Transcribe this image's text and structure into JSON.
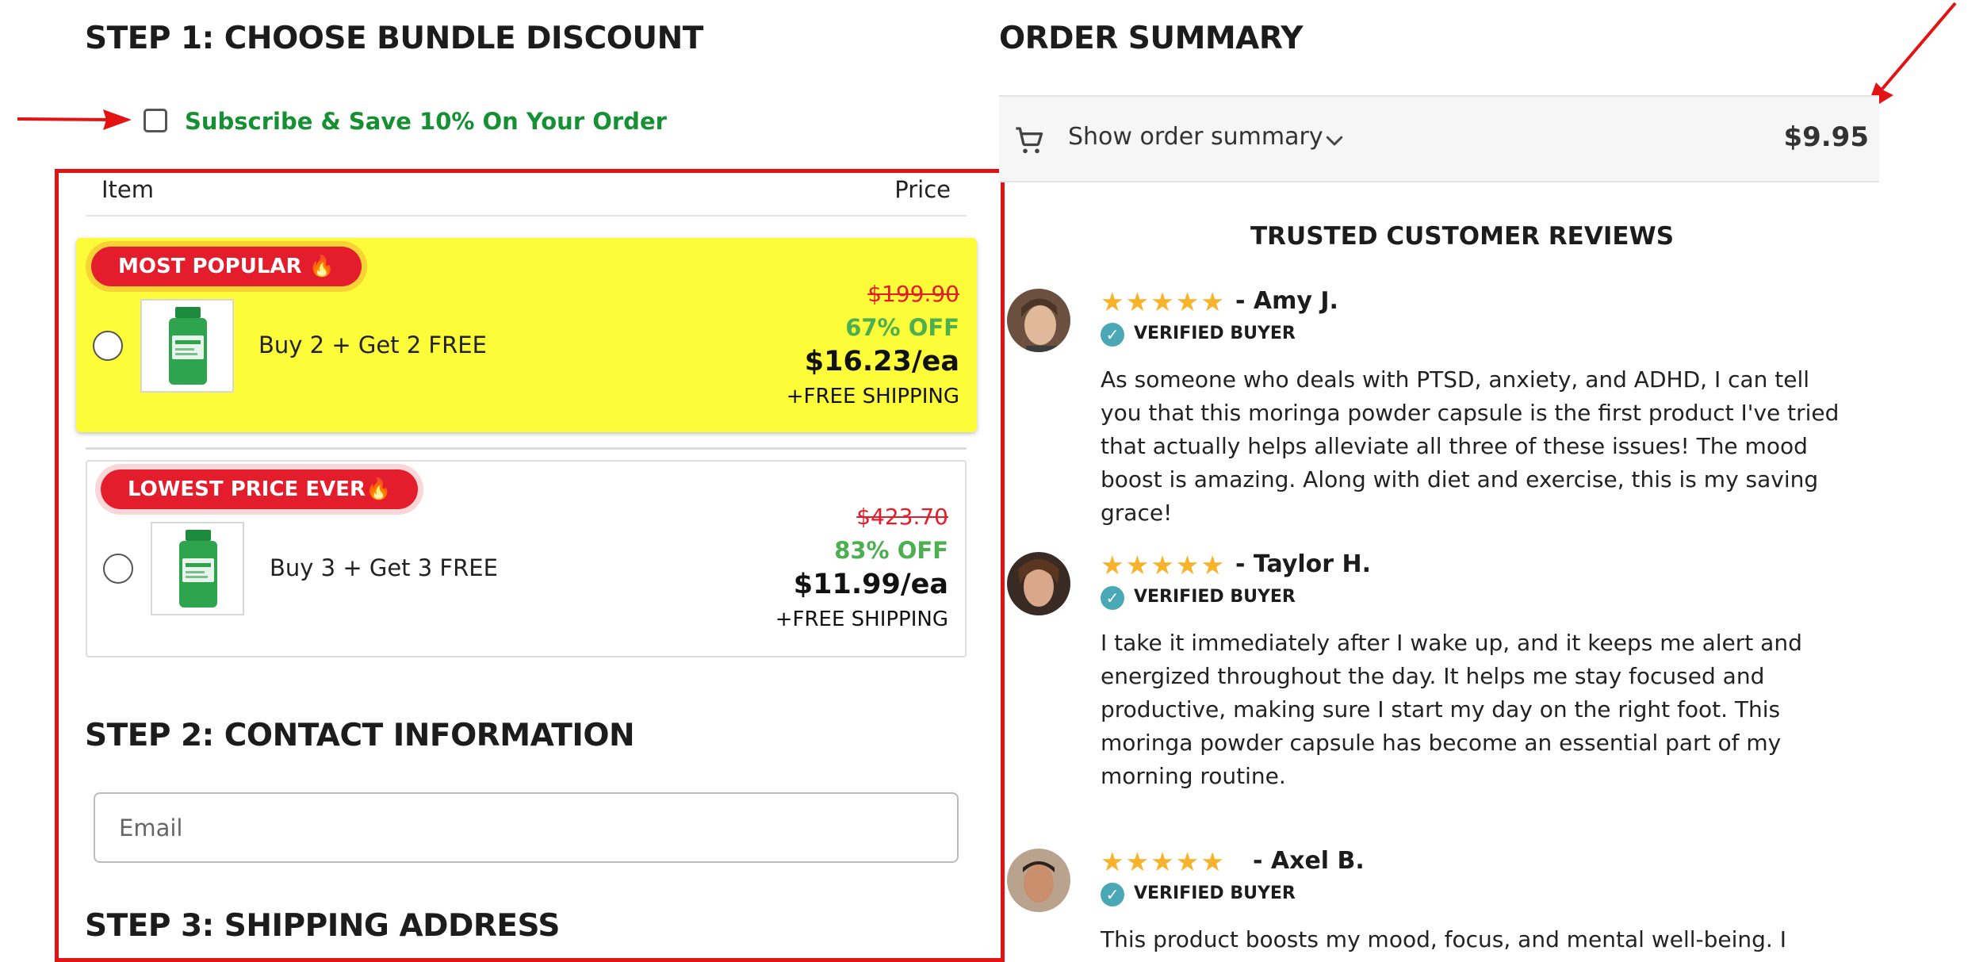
{
  "step1": {
    "title": "STEP 1: CHOOSE BUNDLE DISCOUNT"
  },
  "subscribe": {
    "label": "Subscribe & Save 10% On Your Order",
    "checked": false
  },
  "table": {
    "col_item": "Item",
    "col_price": "Price"
  },
  "bundles": [
    {
      "badge": "MOST POPULAR 🔥",
      "offer": "Buy 2 + Get 2 FREE",
      "original_price": "$199.90",
      "discount": "67% OFF",
      "per_unit": "$16.23/ea",
      "shipping": "+FREE SHIPPING",
      "highlighted": true
    },
    {
      "badge": "LOWEST PRICE EVER🔥",
      "offer": "Buy 3 + Get 3 FREE",
      "original_price": "$423.70",
      "discount": "83% OFF",
      "per_unit": "$11.99/ea",
      "shipping": "+FREE SHIPPING",
      "highlighted": false
    }
  ],
  "step2": {
    "title": "STEP 2: CONTACT INFORMATION",
    "email_placeholder": "Email",
    "email_value": ""
  },
  "step3": {
    "title": "STEP 3: SHIPPING ADDRESS"
  },
  "order_summary": {
    "title": "ORDER SUMMARY",
    "toggle_label": "Show order summary",
    "total": "$9.95",
    "cart_icon": "cart-icon",
    "chevron_icon": "chevron-down-icon"
  },
  "reviews": {
    "title": "TRUSTED CUSTOMER REVIEWS",
    "items": [
      {
        "name": "- Amy J.",
        "rating": 5,
        "verified": "VERIFIED BUYER",
        "text": "As someone who deals with PTSD, anxiety, and ADHD, I can tell you that this moringa powder capsule is the first product I've tried that actually helps alleviate all three of these issues! The mood boost is amazing. Along with diet and exercise, this is my saving grace!"
      },
      {
        "name": "- Taylor H.",
        "rating": 5,
        "verified": "VERIFIED BUYER",
        "text": "I take it immediately after I wake up, and it keeps me alert and energized throughout the day. It helps me stay focused and productive, making sure I start my day on the right foot. This moringa powder capsule has become an essential part of my morning routine."
      },
      {
        "name": "- Axel B.",
        "rating": 5,
        "verified": "VERIFIED BUYER",
        "text": "This product boosts my mood, focus, and mental well-being. I"
      }
    ]
  },
  "colors": {
    "accent_red": "#e31d2b",
    "subscribe_green": "#159033",
    "discount_green": "#4caf50",
    "highlight_yellow": "#fdfc39",
    "star": "#f7b32b",
    "verified_teal": "#4aa8b6"
  }
}
